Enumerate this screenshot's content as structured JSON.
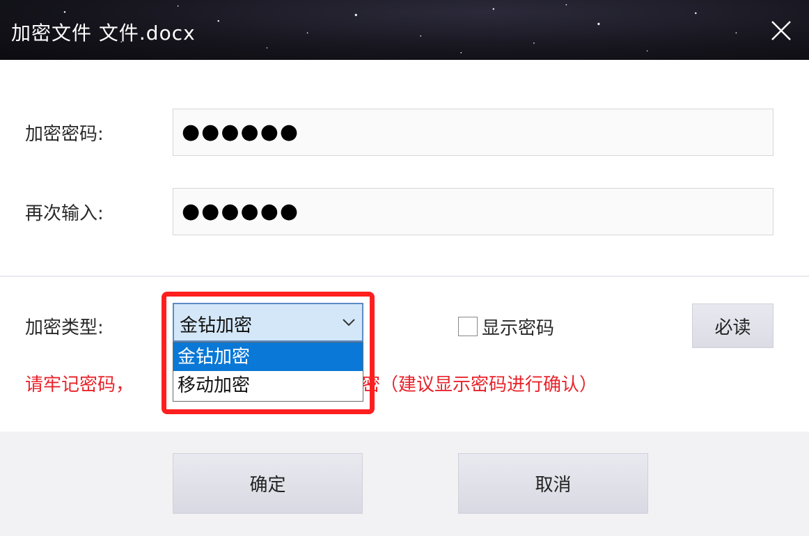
{
  "window": {
    "title": "加密文件 文件.docx",
    "close_icon": "close-icon"
  },
  "form": {
    "password_label": "加密密码:",
    "password_value": "●●●●●●",
    "confirm_label": "再次输入:",
    "confirm_value": "●●●●●●"
  },
  "encryption": {
    "type_label": "加密类型:",
    "selected": "金钻加密",
    "options": [
      "金钻加密",
      "移动加密"
    ],
    "highlight_color": "#ff1f1f",
    "show_password_label": "显示密码",
    "show_password_checked": false,
    "must_read_label": "必读"
  },
  "warning": {
    "text": "请牢记密码，没有密码将无法打开文件，建议设置后再次确认密码（建议显示密码进行确认）",
    "visible_prefix": "请牢记密码，",
    "visible_suffix": "密（建议显示密码进行确认）",
    "color": "#e8232b"
  },
  "footer": {
    "ok_label": "确定",
    "cancel_label": "取消"
  }
}
